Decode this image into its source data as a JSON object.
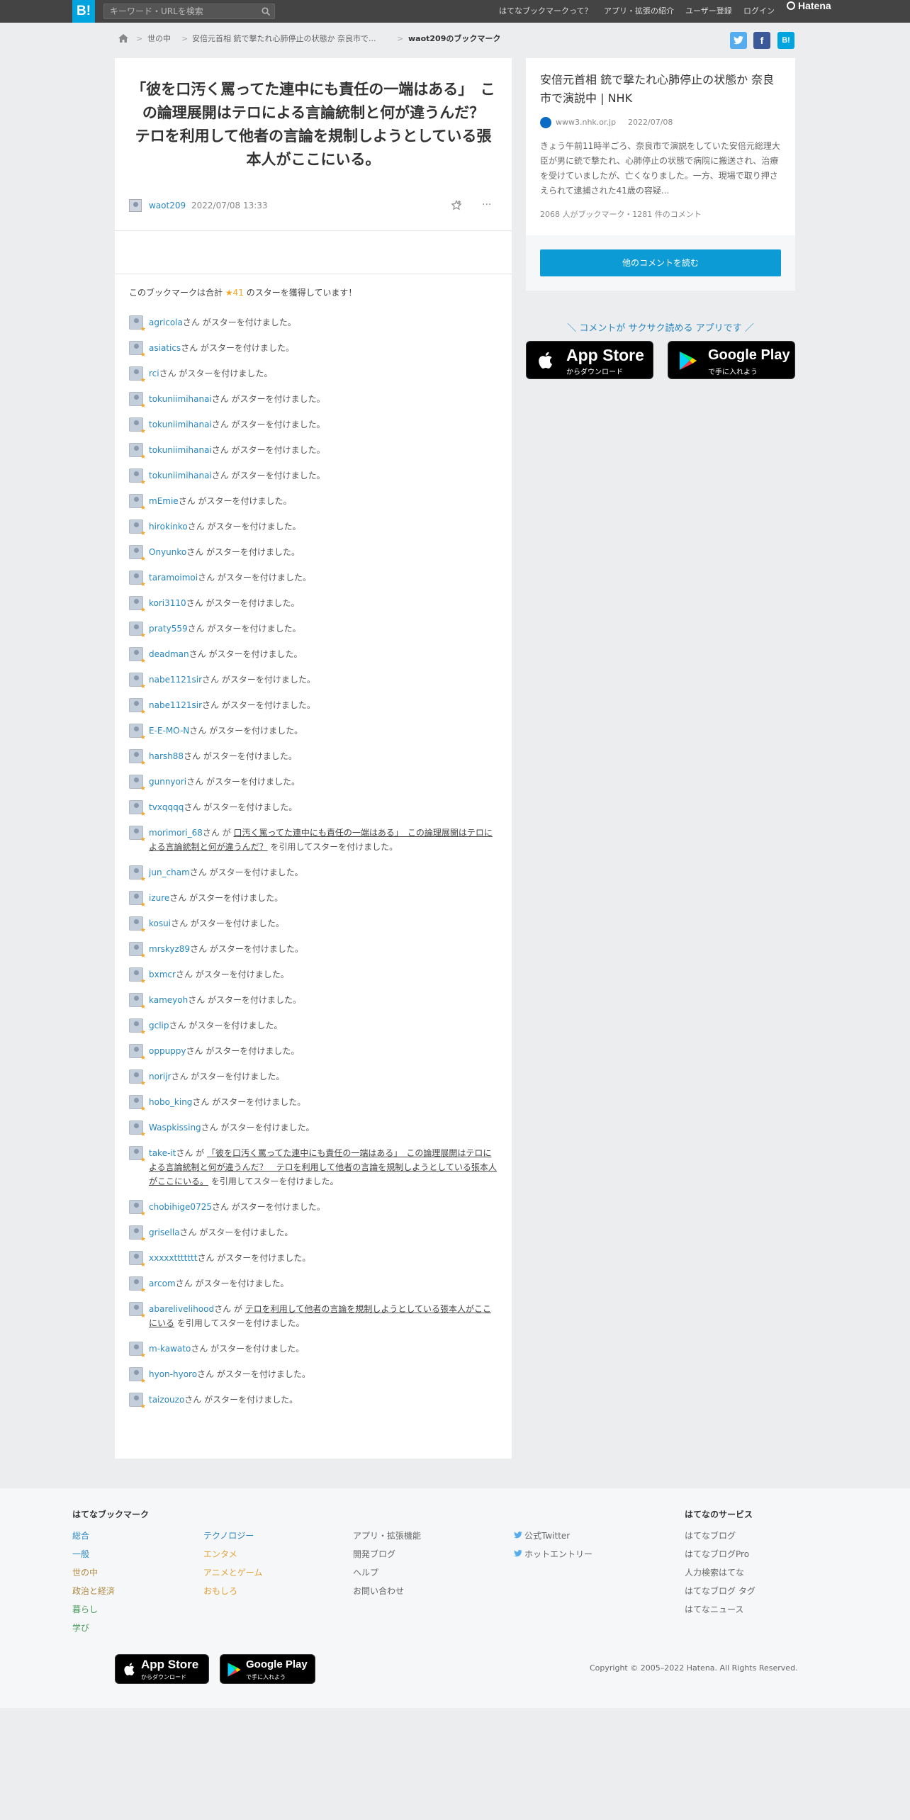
{
  "header": {
    "logo": "B!",
    "search_placeholder": "キーワード・URLを検索",
    "nav": [
      "はてなブックマークって？",
      "アプリ・拡張の紹介",
      "ユーザー登録",
      "ログイン"
    ],
    "brand": "Hatena"
  },
  "breadcrumb": [
    "世の中",
    "安倍元首相 銃で撃たれ心肺停止の状態か 奈良市で...",
    "waot209のブックマーク"
  ],
  "share": {
    "twitter": "twitter-icon",
    "facebook": "f",
    "hatena": "B!"
  },
  "bookmark": {
    "title": "「彼を口汚く罵ってた連中にも責任の一端はある」　この論理展開はテロによる言論統制と何が違うんだ？　テロを利用して他者の言論を規制しようとしている張本人がここにいる。",
    "user": "waot209",
    "date": "2022/07/08 13:33",
    "star_summary_pre": "このブックマークは合計",
    "star_count": "★41",
    "star_summary_post": "のスターを獲得しています！"
  },
  "stars": [
    {
      "name": "agricola",
      "text": "さん がスターを付けました。"
    },
    {
      "name": "asiatics",
      "text": "さん がスターを付けました。"
    },
    {
      "name": "rci",
      "text": "さん がスターを付けました。"
    },
    {
      "name": "tokuniimihanai",
      "text": "さん がスターを付けました。"
    },
    {
      "name": "tokuniimihanai",
      "text": "さん がスターを付けました。"
    },
    {
      "name": "tokuniimihanai",
      "text": "さん がスターを付けました。"
    },
    {
      "name": "tokuniimihanai",
      "text": "さん がスターを付けました。"
    },
    {
      "name": "mEmie",
      "text": "さん がスターを付けました。"
    },
    {
      "name": "hirokinko",
      "text": "さん がスターを付けました。"
    },
    {
      "name": "Onyunko",
      "text": "さん がスターを付けました。"
    },
    {
      "name": "taramoimoi",
      "text": "さん がスターを付けました。"
    },
    {
      "name": "kori3110",
      "text": "さん がスターを付けました。"
    },
    {
      "name": "praty559",
      "text": "さん がスターを付けました。"
    },
    {
      "name": "deadman",
      "text": "さん がスターを付けました。"
    },
    {
      "name": "nabe1121sir",
      "text": "さん がスターを付けました。"
    },
    {
      "name": "nabe1121sir",
      "text": "さん がスターを付けました。"
    },
    {
      "name": "E-E-MO-N",
      "text": "さん がスターを付けました。"
    },
    {
      "name": "harsh88",
      "text": "さん がスターを付けました。"
    },
    {
      "name": "gunnyori",
      "text": "さん がスターを付けました。"
    },
    {
      "name": "tvxqqqq",
      "text": "さん がスターを付けました。"
    },
    {
      "name": "morimori_68",
      "pre": "さん が ",
      "quote": "口汚く罵ってた連中にも責任の一端はある」　この論理展開はテロによる言論統制と何が違うんだ？",
      "post": " を引用してスターを付けました。"
    },
    {
      "name": "jun_cham",
      "text": "さん がスターを付けました。"
    },
    {
      "name": "izure",
      "text": "さん がスターを付けました。"
    },
    {
      "name": "kosui",
      "text": "さん がスターを付けました。"
    },
    {
      "name": "mrskyz89",
      "text": "さん がスターを付けました。"
    },
    {
      "name": "bxmcr",
      "text": "さん がスターを付けました。"
    },
    {
      "name": "kameyoh",
      "text": "さん がスターを付けました。"
    },
    {
      "name": "gclip",
      "text": "さん がスターを付けました。"
    },
    {
      "name": "oppuppy",
      "text": "さん がスターを付けました。"
    },
    {
      "name": "norijr",
      "text": "さん がスターを付けました。"
    },
    {
      "name": "hobo_king",
      "text": "さん がスターを付けました。"
    },
    {
      "name": "Waspkissing",
      "text": "さん がスターを付けました。"
    },
    {
      "name": "take-it",
      "pre": "さん が ",
      "quote": "「彼を口汚く罵ってた連中にも責任の一端はある」　この論理展開はテロによる言論統制と何が違うんだ？　テロを利用して他者の言論を規制しようとしている張本人がここにいる。",
      "post": " を引用してスターを付けました。"
    },
    {
      "name": "chobihige0725",
      "text": "さん がスターを付けました。"
    },
    {
      "name": "grisella",
      "text": "さん がスターを付けました。"
    },
    {
      "name": "xxxxxttttttt",
      "text": "さん がスターを付けました。"
    },
    {
      "name": "arcom",
      "text": "さん がスターを付けました。"
    },
    {
      "name": "abarelivelihood",
      "pre": "さん が ",
      "quote": "テロを利用して他者の言論を規制しようとしている張本人がここにいる",
      "post": " を引用してスターを付けました。"
    },
    {
      "name": "m-kawato",
      "text": "さん がスターを付けました。"
    },
    {
      "name": "hyon-hyoro",
      "text": "さん がスターを付けました。"
    },
    {
      "name": "taizouzo",
      "text": "さん がスターを付けました。"
    }
  ],
  "entry": {
    "title": "安倍元首相 銃で撃たれ心肺停止の状態か 奈良市で演説中 | NHK",
    "domain": "www3.nhk.or.jp",
    "date": "2022/07/08",
    "summary": "きょう午前11時半ごろ、奈良市で演説をしていた安倍元総理大臣が男に銃で撃たれ、心肺停止の状態で病院に搬送され、治療を受けていましたが、亡くなりました。一方、現場で取り押さえられて逮捕された41歳の容疑...",
    "counts": "2068 人がブックマーク・1281 件のコメント",
    "read_button": "他のコメントを読む"
  },
  "app_promo": "＼ コメントが サクサク読める アプリです ／",
  "stores": {
    "apple_big": "App Store",
    "apple_small": "からダウンロード",
    "google_big": "Google Play",
    "google_small": "で手に入れよう"
  },
  "footer": {
    "title": "はてなブックマーク",
    "col1": [
      "総合",
      "一般",
      "世の中",
      "政治と経済",
      "暮らし",
      "学び"
    ],
    "col2": [
      "テクノロジー",
      "エンタメ",
      "アニメとゲーム",
      "おもしろ"
    ],
    "col3": [
      "アプリ・拡張機能",
      "開発ブログ",
      "ヘルプ",
      "お問い合わせ"
    ],
    "col4": [
      "公式Twitter",
      "ホットエントリー"
    ],
    "services_title": "はてなのサービス",
    "services": [
      "はてなブログ",
      "はてなブログPro",
      "人力検索はてな",
      "はてなブログ タグ",
      "はてなニュース"
    ],
    "copyright": "Copyright © 2005–2022 Hatena. All Rights Reserved."
  },
  "colors": {
    "accent": "#00a4de",
    "star": "#f5a623",
    "button": "#0d9bd5"
  }
}
